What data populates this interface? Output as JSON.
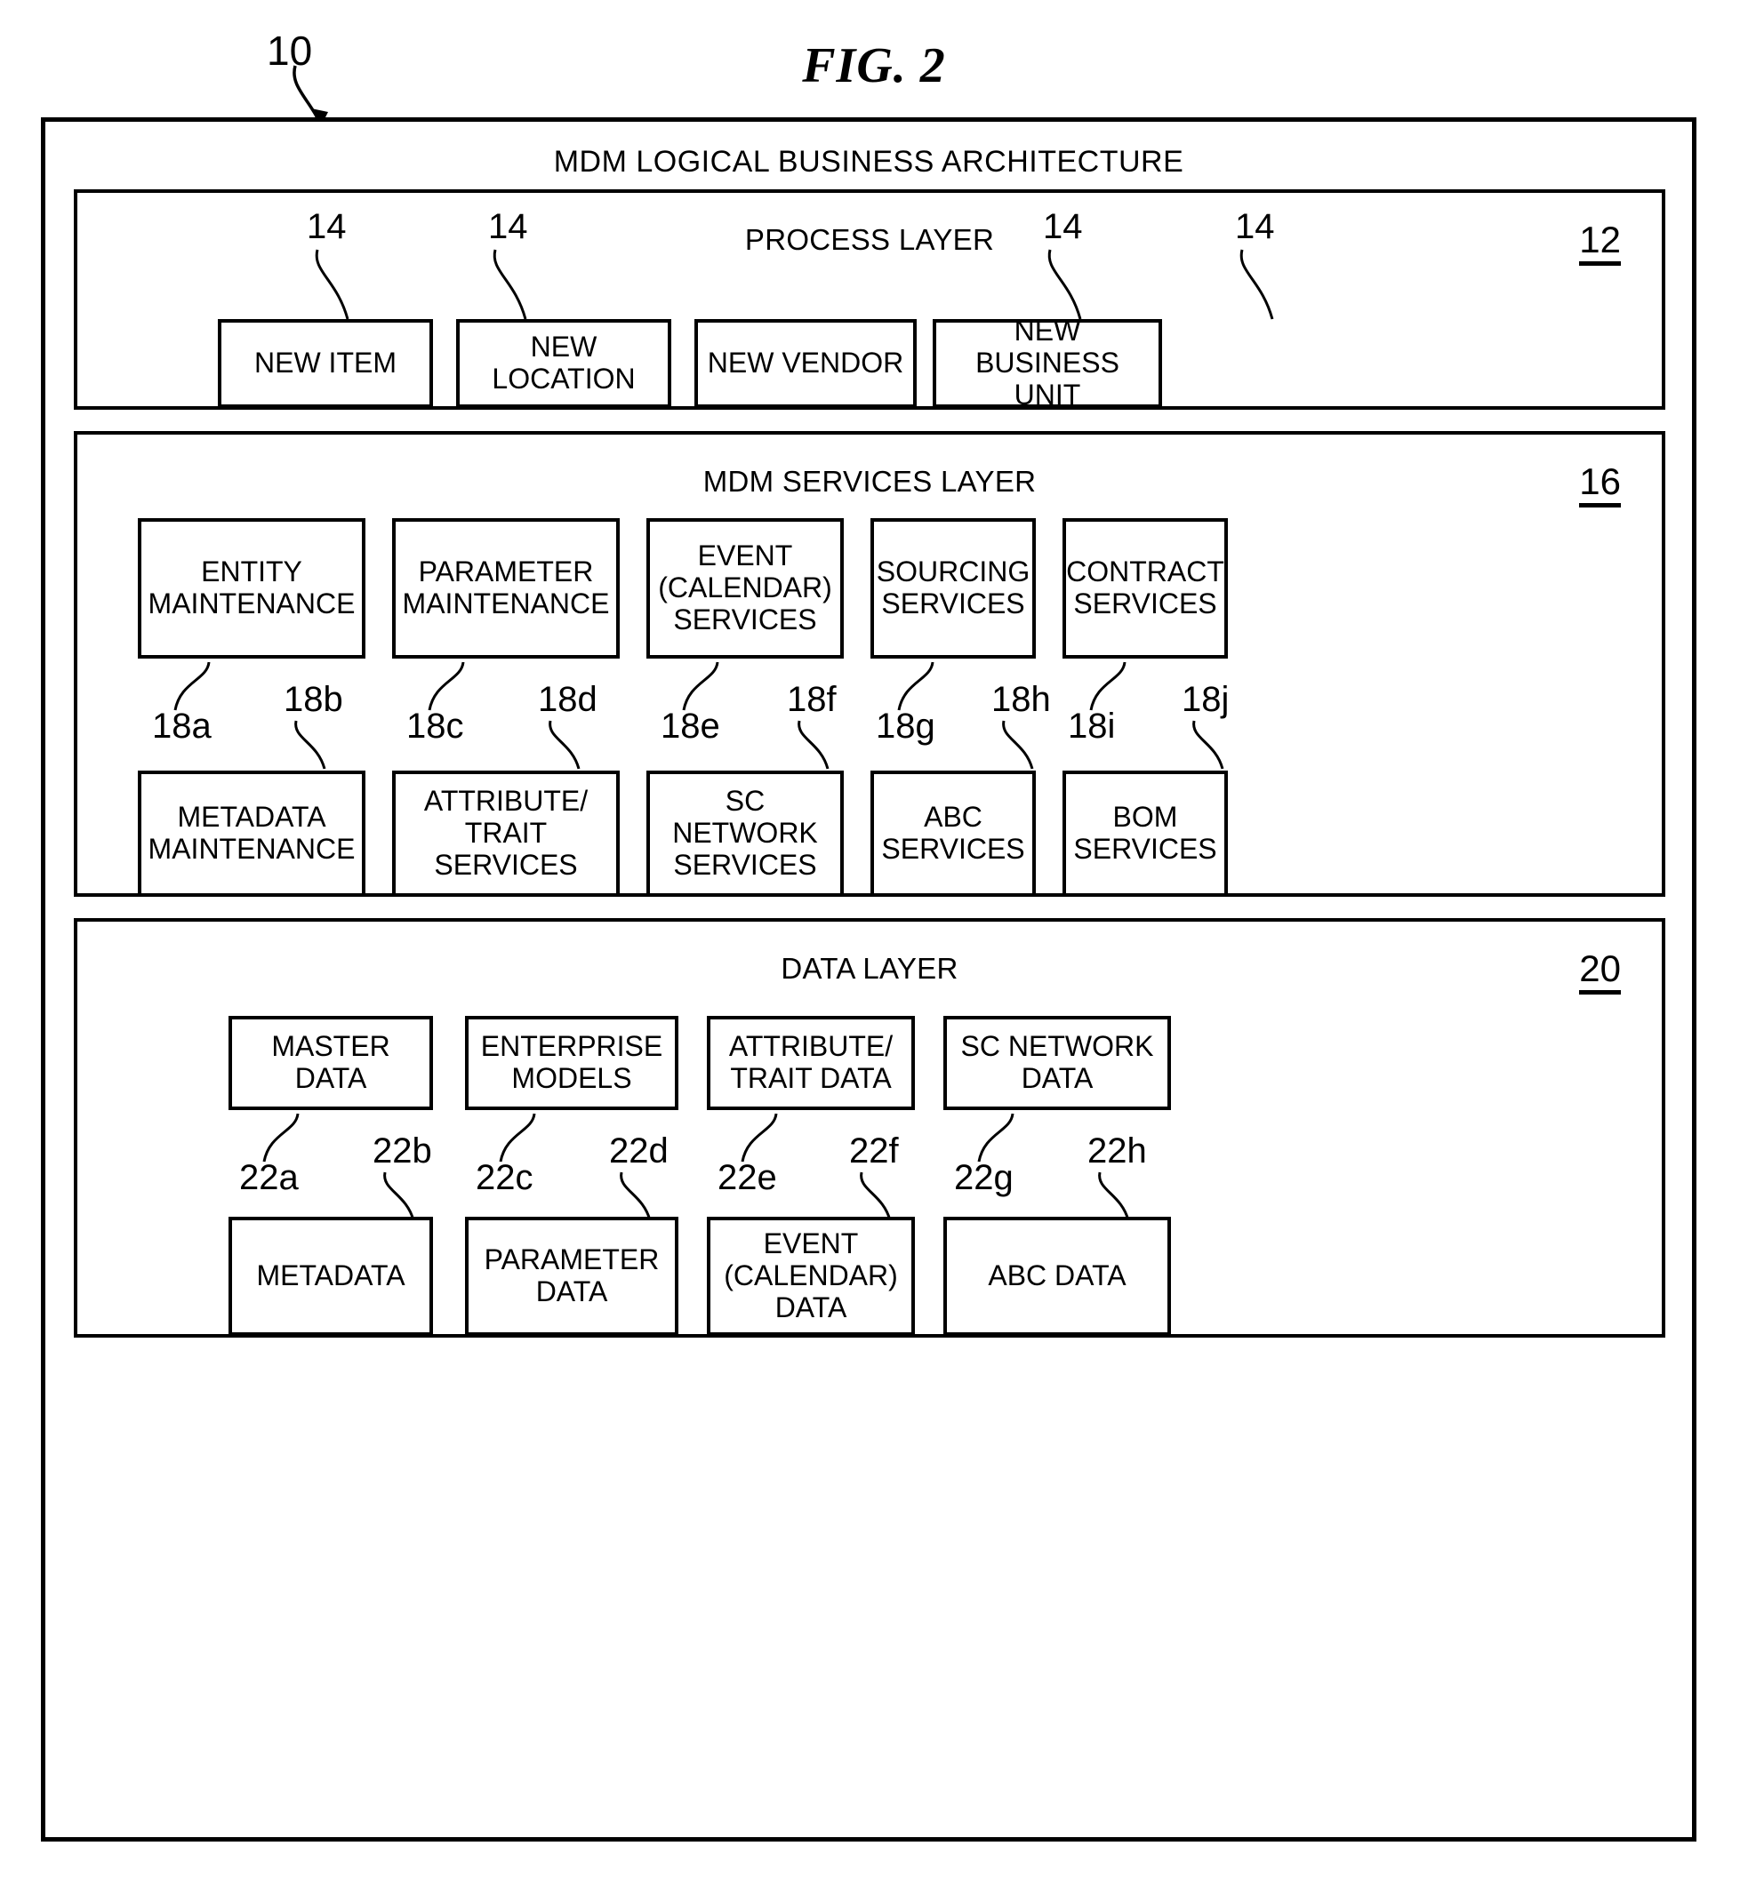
{
  "figure": {
    "label": "FIG. 2",
    "system_ref": "10"
  },
  "architecture": {
    "title": "MDM LOGICAL BUSINESS ARCHITECTURE"
  },
  "process_layer": {
    "title": "PROCESS LAYER",
    "ref": "12",
    "item_ref": "14",
    "boxes": [
      {
        "label": "NEW ITEM",
        "ref": "14"
      },
      {
        "label": "NEW\nLOCATION",
        "ref": "14"
      },
      {
        "label": "NEW VENDOR",
        "ref": "14"
      },
      {
        "label": "NEW BUSINESS\nUNIT",
        "ref": "14"
      }
    ]
  },
  "services_layer": {
    "title": "MDM SERVICES LAYER",
    "ref": "16",
    "top_boxes": [
      {
        "label": "ENTITY\nMAINTENANCE",
        "ref": "18a"
      },
      {
        "label": "PARAMETER\nMAINTENANCE",
        "ref": "18c"
      },
      {
        "label": "EVENT\n(CALENDAR)\nSERVICES",
        "ref": "18e"
      },
      {
        "label": "SOURCING\nSERVICES",
        "ref": "18g"
      },
      {
        "label": "CONTRACT\nSERVICES",
        "ref": "18i"
      }
    ],
    "bottom_boxes": [
      {
        "label": "METADATA\nMAINTENANCE",
        "ref": "18b"
      },
      {
        "label": "ATTRIBUTE/\nTRAIT SERVICES",
        "ref": "18d"
      },
      {
        "label": "SC\nNETWORK\nSERVICES",
        "ref": "18f"
      },
      {
        "label": "ABC\nSERVICES",
        "ref": "18h"
      },
      {
        "label": "BOM\nSERVICES",
        "ref": "18j"
      }
    ]
  },
  "data_layer": {
    "title": "DATA LAYER",
    "ref": "20",
    "top_boxes": [
      {
        "label": "MASTER\nDATA",
        "ref": "22a"
      },
      {
        "label": "ENTERPRISE\nMODELS",
        "ref": "22c"
      },
      {
        "label": "ATTRIBUTE/\nTRAIT DATA",
        "ref": "22e"
      },
      {
        "label": "SC NETWORK\nDATA",
        "ref": "22g"
      }
    ],
    "bottom_boxes": [
      {
        "label": "METADATA",
        "ref": "22b"
      },
      {
        "label": "PARAMETER\nDATA",
        "ref": "22d"
      },
      {
        "label": "EVENT\n(CALENDAR)\nDATA",
        "ref": "22f"
      },
      {
        "label": "ABC DATA",
        "ref": "22h"
      }
    ]
  }
}
